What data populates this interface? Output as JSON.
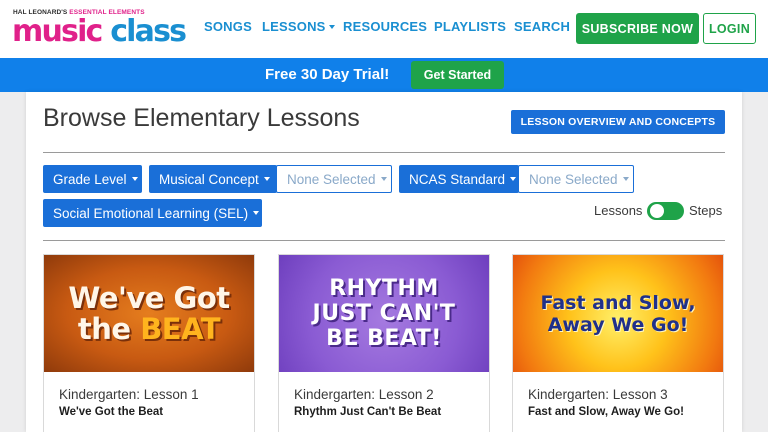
{
  "logo": {
    "brand_prefix": "HAL LEONARD'S",
    "brand_ee": "ESSENTIAL ELEMENTS",
    "word_music": "music",
    "word_class": "class"
  },
  "nav": {
    "items": [
      {
        "label": "SONGS"
      },
      {
        "label": "LESSONS"
      },
      {
        "label": "RESOURCES"
      },
      {
        "label": "PLAYLISTS"
      },
      {
        "label": "SEARCH"
      }
    ],
    "subscribe_label": "SUBSCRIBE NOW",
    "login_label": "LOGIN"
  },
  "banner": {
    "text": "Free 30 Day Trial!",
    "button_label": "Get Started"
  },
  "page": {
    "title": "Browse Elementary Lessons",
    "overview_button": "LESSON OVERVIEW AND CONCEPTS"
  },
  "filters": {
    "grade_level": "Grade Level",
    "musical_concept": "Musical Concept",
    "musical_concept_value": "None Selected",
    "ncas_standard": "NCAS Standard",
    "ncas_standard_value": "None Selected",
    "sel": "Social Emotional Learning (SEL)"
  },
  "view_toggle": {
    "left_label": "Lessons",
    "right_label": "Steps"
  },
  "lessons": [
    {
      "thumb_line1": "We've Got",
      "thumb_line2a": "the ",
      "thumb_line2b": "BEAT",
      "subtitle": "Kindergarten: Lesson 1",
      "title": "We've Got the Beat"
    },
    {
      "thumb_line1": "RHYTHM",
      "thumb_line2": "JUST CAN'T",
      "thumb_line3": "BE BEAT!",
      "subtitle": "Kindergarten: Lesson 2",
      "title": "Rhythm Just Can't Be Beat"
    },
    {
      "thumb_line1": "Fast and Slow,",
      "thumb_line2": "Away We Go!",
      "subtitle": "Kindergarten: Lesson 3",
      "title": "Fast and Slow, Away We Go!"
    }
  ],
  "colors": {
    "brand_blue": "#1a8fd1",
    "brand_pink": "#e0218a",
    "green": "#1fa349",
    "banner_blue": "#1080ea",
    "button_blue": "#1a6fd8"
  }
}
